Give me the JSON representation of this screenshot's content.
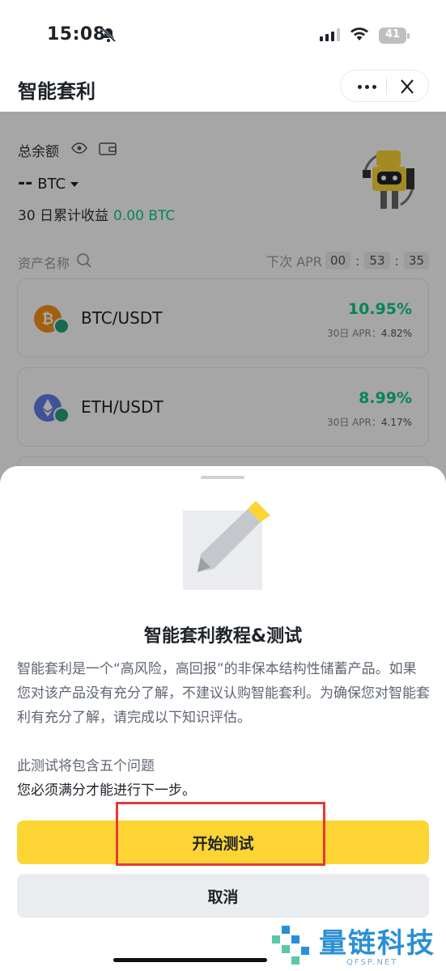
{
  "status_bar": {
    "time": "15:08",
    "battery": "41"
  },
  "header": {
    "title": "智能套利"
  },
  "balance": {
    "label": "总余额",
    "value_dash": "--",
    "currency": "BTC",
    "profit_label": "30 日累计收益",
    "profit_value": "0.00 BTC"
  },
  "list": {
    "asset_name_label": "资产名称",
    "next_apr_label": "下次 APR",
    "timer": {
      "hours": "00",
      "minutes": "53",
      "seconds": "35"
    }
  },
  "assets": [
    {
      "pair": "BTC/USDT",
      "apr": "10.95%",
      "apr_30d_label": "30日 APR：",
      "apr_30d": "4.82%",
      "icon": "btc-icon",
      "color": "#f7931a"
    },
    {
      "pair": "ETH/USDT",
      "apr": "8.99%",
      "apr_30d_label": "30日 APR：",
      "apr_30d": "4.17%",
      "icon": "eth-icon",
      "color": "#627eea"
    }
  ],
  "sheet": {
    "title": "智能套利教程&测试",
    "body": "智能套利是一个“高风险，高回报”的非保本结构性储蓄产品。如果您对该产品没有充分了解，不建议认购智能套利。为确保您对智能套利有充分了解，请完成以下知识评估。",
    "note_line1": "此测试将包含五个问题",
    "note_line2": "您必须满分才能进行下一步。",
    "start_label": "开始测试",
    "cancel_label": "取消"
  },
  "watermark": {
    "text": "量链科技",
    "sub": "QFSP.NET"
  },
  "colors": {
    "accent": "#fcd535",
    "positive": "#0ecb81",
    "highlight": "#e53935"
  }
}
